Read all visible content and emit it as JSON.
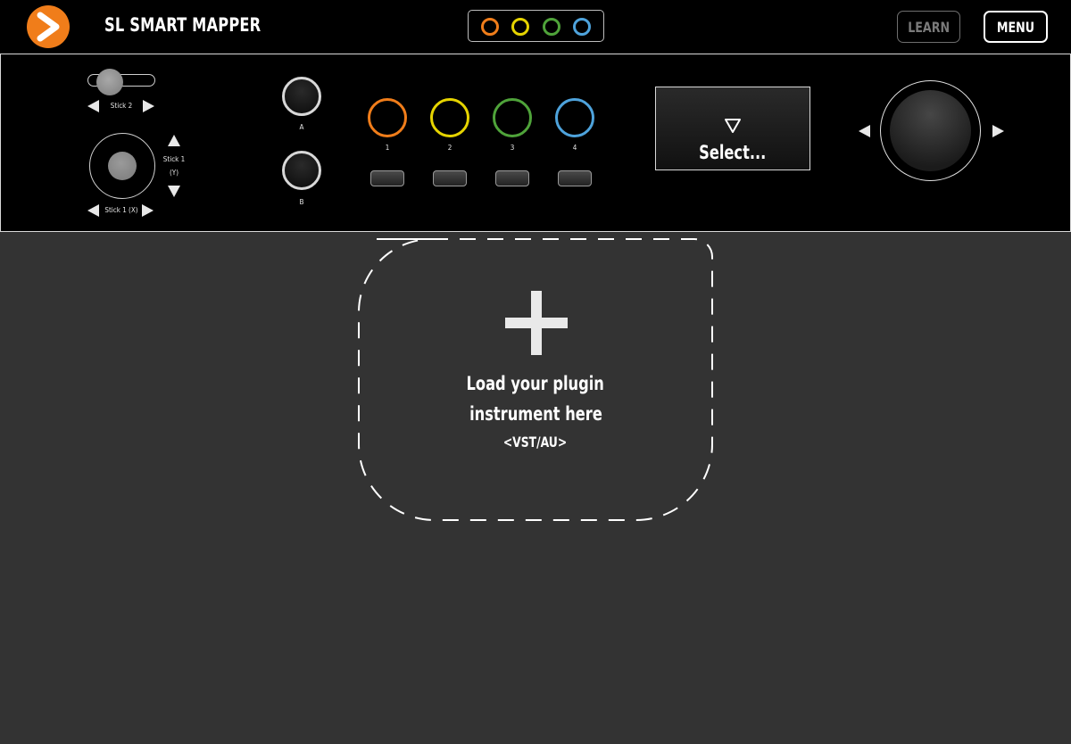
{
  "header": {
    "title": "SL SMART MAPPER",
    "learn_label": "LEARN",
    "menu_label": "MENU",
    "logo_icon": "chevron-right-icon",
    "color_dots": [
      "#f07d1a",
      "#e6d400",
      "#4fa33a",
      "#4ea3dc"
    ]
  },
  "controls": {
    "stick2_label": "Stick 2",
    "stick1_y_label_1": "Stick 1",
    "stick1_y_label_2": "(Y)",
    "stick1_x_label": "Stick 1 (X)",
    "button_a_label": "A",
    "button_b_label": "B",
    "pads": [
      {
        "label": "1",
        "color": "#f07d1a"
      },
      {
        "label": "2",
        "color": "#e6d400"
      },
      {
        "label": "3",
        "color": "#4fa33a"
      },
      {
        "label": "4",
        "color": "#4ea3dc"
      }
    ],
    "selector_text": "Select..."
  },
  "dropzone": {
    "line1": "Load your plugin",
    "line2": "instrument here",
    "line3": "<VST/AU>"
  }
}
